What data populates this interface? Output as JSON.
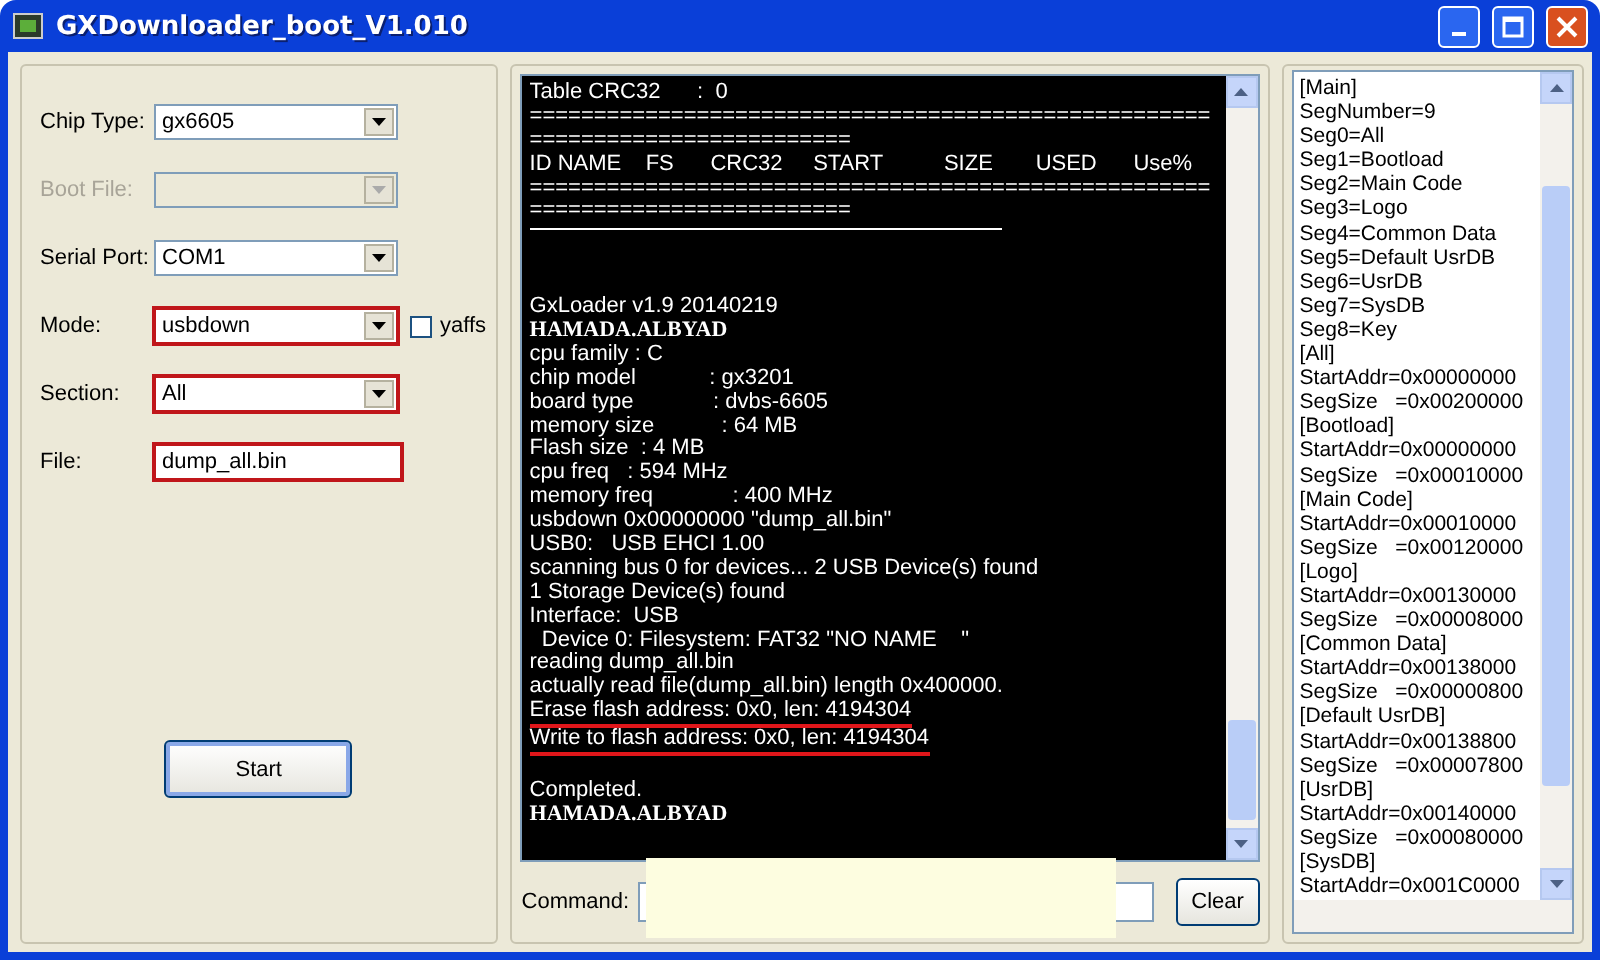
{
  "window": {
    "title": "GXDownloader_boot_V1.010"
  },
  "form": {
    "fields": [
      {
        "kind": "combo",
        "label": "Chip Type:",
        "value": "gx6605",
        "disabled": false,
        "highlighted": false
      },
      {
        "kind": "combo",
        "label": "Boot File:",
        "disabled": true,
        "highlighted": false
      },
      {
        "kind": "combo",
        "label": "Serial Port:",
        "value": "COM1",
        "disabled": false,
        "highlighted": false
      },
      {
        "kind": "combo",
        "label": "Mode:",
        "value": "usbdown",
        "disabled": false,
        "highlighted": true,
        "checkbox": {
          "label": "yaffs",
          "checked": false
        }
      },
      {
        "kind": "combo",
        "label": "Section:",
        "value": "All",
        "disabled": false,
        "highlighted": true
      },
      {
        "kind": "text",
        "label": "File:",
        "value": "dump_all.bin",
        "disabled": false,
        "highlighted": true
      }
    ],
    "start_button": "Start"
  },
  "log": {
    "lines": [
      {
        "kind": "text",
        "text": "Table CRC32      :  0",
        "highlighted": false
      },
      {
        "kind": "text",
        "text": "=====================================================",
        "highlighted": false
      },
      {
        "kind": "text",
        "text": "=========================",
        "highlighted": false
      },
      {
        "kind": "text",
        "text": "ID NAME    FS      CRC32     START          SIZE       USED      Use%",
        "highlighted": false
      },
      {
        "kind": "text",
        "text": "=====================================================",
        "highlighted": false
      },
      {
        "kind": "text",
        "text": "=========================",
        "highlighted": false
      },
      {
        "kind": "rule"
      },
      {
        "kind": "blank"
      },
      {
        "kind": "blank"
      },
      {
        "kind": "text",
        "text": "GxLoader v1.9 20140219",
        "highlighted": false
      },
      {
        "kind": "bold",
        "text": "HAMADA.ALBYAD",
        "highlighted": false
      },
      {
        "kind": "text",
        "text": "cpu family : C",
        "highlighted": false
      },
      {
        "kind": "text",
        "text": "chip model            : gx3201",
        "highlighted": false
      },
      {
        "kind": "text",
        "text": "board type             : dvbs-6605",
        "highlighted": false
      },
      {
        "kind": "text",
        "text": "memory size           : 64 MB",
        "highlighted": false
      },
      {
        "kind": "text",
        "text": "Flash size  : 4 MB",
        "highlighted": false
      },
      {
        "kind": "text",
        "text": "cpu freq   : 594 MHz",
        "highlighted": false
      },
      {
        "kind": "text",
        "text": "memory freq             : 400 MHz",
        "highlighted": false
      },
      {
        "kind": "text",
        "text": "usbdown 0x00000000 \"dump_all.bin\"",
        "highlighted": false
      },
      {
        "kind": "text",
        "text": "USB0:   USB EHCI 1.00",
        "highlighted": false
      },
      {
        "kind": "text",
        "text": "scanning bus 0 for devices... 2 USB Device(s) found",
        "highlighted": false
      },
      {
        "kind": "text",
        "text": "1 Storage Device(s) found",
        "highlighted": false
      },
      {
        "kind": "text",
        "text": "Interface:  USB",
        "highlighted": false
      },
      {
        "kind": "text",
        "text": "  Device 0: Filesystem: FAT32 \"NO NAME    \"",
        "highlighted": false
      },
      {
        "kind": "text",
        "text": "reading dump_all.bin",
        "highlighted": false
      },
      {
        "kind": "text",
        "text": "actually read file(dump_all.bin) length 0x400000.",
        "highlighted": false
      },
      {
        "kind": "text",
        "text": "Erase flash address: 0x0, len: 4194304",
        "highlighted": true
      },
      {
        "kind": "text",
        "text": "Write to flash address: 0x0, len: 4194304",
        "highlighted": true
      },
      {
        "kind": "blank"
      },
      {
        "kind": "text",
        "text": "Completed.",
        "highlighted": false
      },
      {
        "kind": "bold",
        "text": "HAMADA.ALBYAD",
        "highlighted": false
      }
    ],
    "command": {
      "label": "Command:",
      "covered": true
    },
    "clear_button": "Clear"
  },
  "config": {
    "lines": [
      "[Main]",
      "SegNumber=9",
      "Seg0=All",
      "Seg1=Bootload",
      "Seg2=Main Code",
      "Seg3=Logo",
      "Seg4=Common Data",
      "Seg5=Default UsrDB",
      "Seg6=UsrDB",
      "Seg7=SysDB",
      "Seg8=Key",
      "[All]",
      "StartAddr=0x00000000",
      "SegSize   =0x00200000",
      "[Bootload]",
      "StartAddr=0x00000000",
      "SegSize   =0x00010000",
      "[Main Code]",
      "StartAddr=0x00010000",
      "SegSize   =0x00120000",
      "[Logo]",
      "StartAddr=0x00130000",
      "SegSize   =0x00008000",
      "[Common Data]",
      "StartAddr=0x00138000",
      "SegSize   =0x00000800",
      "[Default UsrDB]",
      "StartAddr=0x00138800",
      "SegSize   =0x00007800",
      "[UsrDB]",
      "StartAddr=0x00140000",
      "SegSize   =0x00080000",
      "[SysDB]",
      "StartAddr=0x001C0000"
    ]
  }
}
